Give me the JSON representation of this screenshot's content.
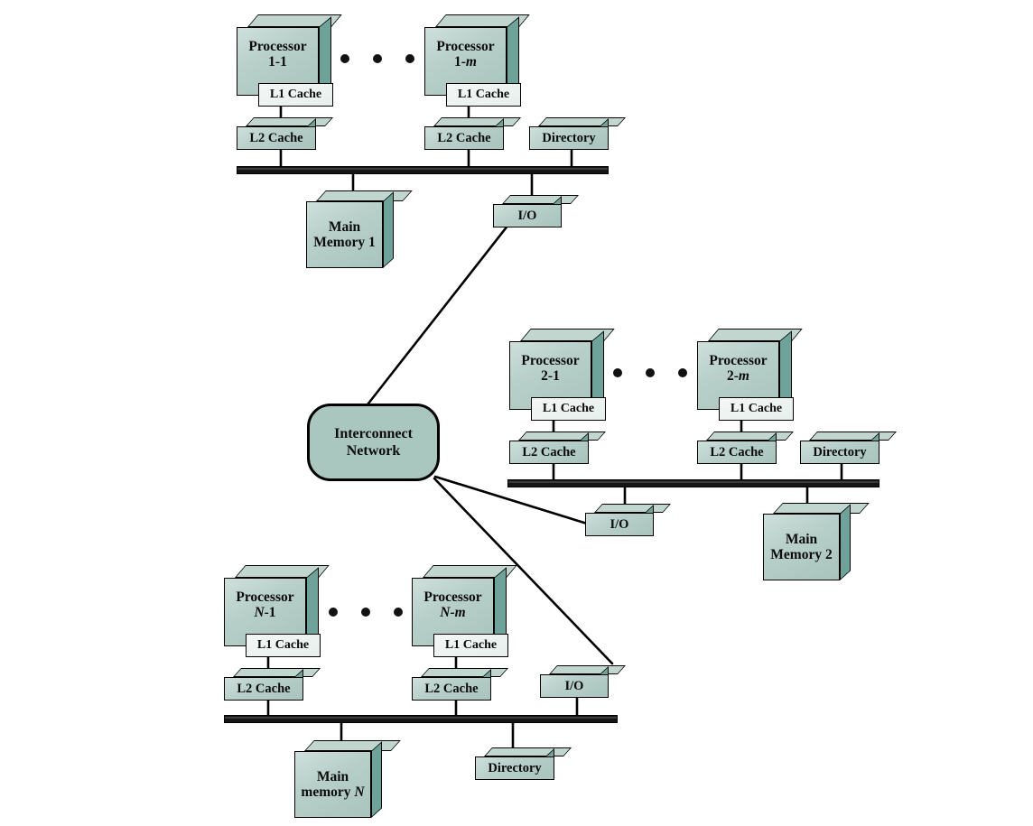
{
  "diagram": {
    "title": "Multiprocessor cluster interconnect diagram",
    "colors": {
      "box_front_light": "#cfe0db",
      "box_front_dark": "#a8c4bd",
      "box_top": "#c2d6d0",
      "box_side": "#6fa39a",
      "subbox_fill": "#eef4f1",
      "bus": "#151515",
      "line": "#000000",
      "network_fill": "#a9c6bf",
      "background": "#ffffff"
    },
    "network": {
      "line1": "Interconnect",
      "line2": "Network"
    },
    "clusters": [
      {
        "id": "cluster-1",
        "processors": [
          {
            "line1": "Processor",
            "line2_pre": "1-1",
            "line2_em": "",
            "l1": "L1 Cache",
            "l2": "L2 Cache"
          },
          {
            "line1": "Processor",
            "line2_pre": "1-",
            "line2_em": "m",
            "l1": "L1 Cache",
            "l2": "L2 Cache"
          }
        ],
        "directory": "Directory",
        "io": "I/O",
        "memory_line1": "Main",
        "memory_line2_pre": "Memory 1",
        "memory_line2_em": ""
      },
      {
        "id": "cluster-2",
        "processors": [
          {
            "line1": "Processor",
            "line2_pre": "2-1",
            "line2_em": "",
            "l1": "L1 Cache",
            "l2": "L2 Cache"
          },
          {
            "line1": "Processor",
            "line2_pre": "2-",
            "line2_em": "m",
            "l1": "L1 Cache",
            "l2": "L2 Cache"
          }
        ],
        "directory": "Directory",
        "io": "I/O",
        "memory_line1": "Main",
        "memory_line2_pre": "Memory 2",
        "memory_line2_em": ""
      },
      {
        "id": "cluster-n",
        "processors": [
          {
            "line1": "Processor",
            "line2_pre": "",
            "line2_em": "N",
            "line2_post": "-1",
            "l1": "L1 Cache",
            "l2": "L2 Cache"
          },
          {
            "line1": "Processor",
            "line2_pre": "",
            "line2_em": "N-m",
            "line2_post": "",
            "l1": "L1 Cache",
            "l2": "L2 Cache"
          }
        ],
        "directory": "Directory",
        "io": "I/O",
        "memory_line1": "Main",
        "memory_line2_pre": "memory ",
        "memory_line2_em": "N"
      }
    ]
  }
}
